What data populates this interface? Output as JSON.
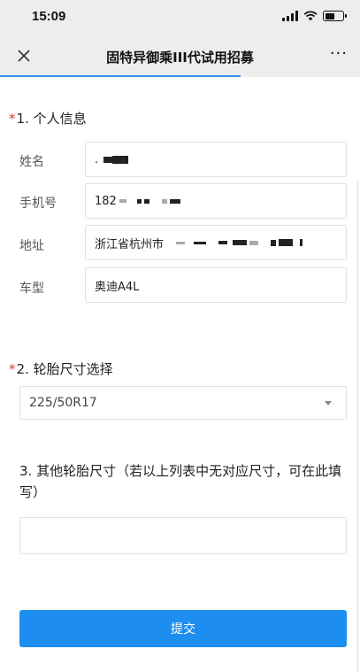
{
  "status_bar": {
    "time": "15:09"
  },
  "nav": {
    "title": "固特异御乘III代试用招募",
    "more": "···"
  },
  "q1": {
    "required_mark": "*",
    "title": "1. 个人信息",
    "rows": [
      {
        "label": "姓名",
        "value": "."
      },
      {
        "label": "手机号",
        "value": "182"
      },
      {
        "label": "地址",
        "value": "浙江省杭州市"
      },
      {
        "label": "车型",
        "value": "奥迪A4L"
      }
    ]
  },
  "q2": {
    "required_mark": "*",
    "title": "2. 轮胎尺寸选择",
    "selected": "225/50R17"
  },
  "q3": {
    "title": "3. 其他轮胎尺寸（若以上列表中无对应尺寸，可在此填写）",
    "value": ""
  },
  "submit": {
    "label": "提交"
  },
  "colors": {
    "accent": "#1d8ef0",
    "required": "#e23b3b",
    "progress": "#2f8fe8"
  }
}
